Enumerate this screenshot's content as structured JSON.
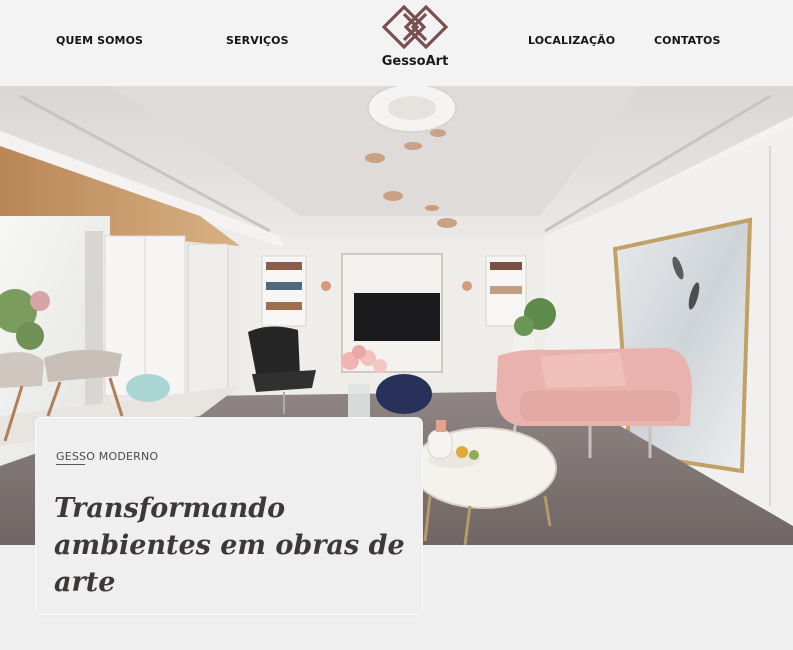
{
  "nav": {
    "quem_somos": "QUEM SOMOS",
    "servicos": "SERVIÇOS",
    "localizacao": "LOCALIZAÇÃO",
    "contatos": "CONTATOS"
  },
  "brand": {
    "name": "GessoArt",
    "logo_color": "#7a4f4f"
  },
  "hero": {
    "kicker": "GESSO MODERNO",
    "title": "Transformando ambientes em obras de arte"
  },
  "colors": {
    "header_bg": "#f4f3f3",
    "page_bg": "#efefef",
    "text_dark": "#151515",
    "title_text": "#3e3838"
  }
}
